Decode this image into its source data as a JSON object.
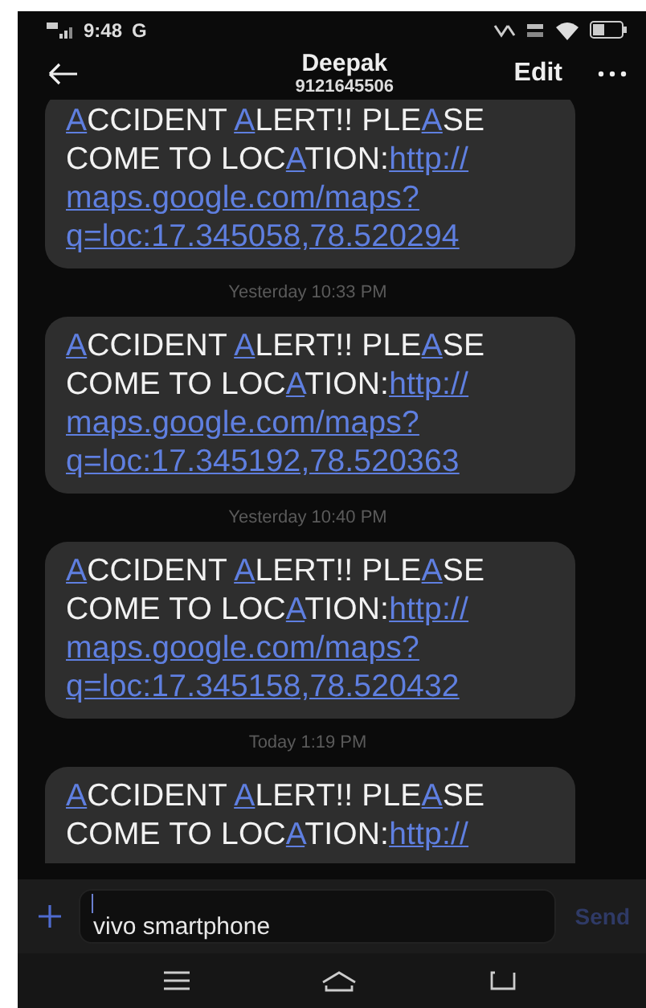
{
  "status_bar": {
    "time": "9:48",
    "carrier_letter": "G"
  },
  "header": {
    "contact_name": "Deepak",
    "phone_number": "9121645506",
    "edit_label": "Edit"
  },
  "messages": [
    {
      "kind": "message",
      "lines": [
        [
          {
            "text": "A",
            "link": true
          },
          {
            "text": "CCIDENT ",
            "link": false
          },
          {
            "text": "A",
            "link": true
          },
          {
            "text": "LERT!! PLE",
            "link": false
          },
          {
            "text": "A",
            "link": true
          },
          {
            "text": "SE",
            "link": false
          }
        ],
        [
          {
            "text": "COME TO LOC",
            "link": false
          },
          {
            "text": "A",
            "link": true
          },
          {
            "text": "TION:",
            "link": false
          },
          {
            "text": "http://",
            "link": true
          }
        ],
        [
          {
            "text": "maps.google.com/maps?",
            "link": true
          }
        ],
        [
          {
            "text": "q=loc:17.345058,78.520294",
            "link": true
          }
        ]
      ]
    },
    {
      "kind": "timestamp",
      "text": "Yesterday 10:33 PM"
    },
    {
      "kind": "message",
      "lines": [
        [
          {
            "text": "A",
            "link": true
          },
          {
            "text": "CCIDENT ",
            "link": false
          },
          {
            "text": "A",
            "link": true
          },
          {
            "text": "LERT!! PLE",
            "link": false
          },
          {
            "text": "A",
            "link": true
          },
          {
            "text": "SE",
            "link": false
          }
        ],
        [
          {
            "text": "COME TO LOC",
            "link": false
          },
          {
            "text": "A",
            "link": true
          },
          {
            "text": "TION:",
            "link": false
          },
          {
            "text": "http://",
            "link": true
          }
        ],
        [
          {
            "text": "maps.google.com/maps?",
            "link": true
          }
        ],
        [
          {
            "text": "q=loc:17.345192,78.520363",
            "link": true
          }
        ]
      ]
    },
    {
      "kind": "timestamp",
      "text": "Yesterday 10:40 PM"
    },
    {
      "kind": "message",
      "lines": [
        [
          {
            "text": "A",
            "link": true
          },
          {
            "text": "CCIDENT ",
            "link": false
          },
          {
            "text": "A",
            "link": true
          },
          {
            "text": "LERT!! PLE",
            "link": false
          },
          {
            "text": "A",
            "link": true
          },
          {
            "text": "SE",
            "link": false
          }
        ],
        [
          {
            "text": "COME TO LOC",
            "link": false
          },
          {
            "text": "A",
            "link": true
          },
          {
            "text": "TION:",
            "link": false
          },
          {
            "text": "http://",
            "link": true
          }
        ],
        [
          {
            "text": "maps.google.com/maps?",
            "link": true
          }
        ],
        [
          {
            "text": "q=loc:17.345158,78.520432",
            "link": true
          }
        ]
      ]
    },
    {
      "kind": "timestamp",
      "text": "Today 1:19 PM"
    },
    {
      "kind": "message",
      "lines": [
        [
          {
            "text": "A",
            "link": true
          },
          {
            "text": "CCIDENT ",
            "link": false
          },
          {
            "text": "A",
            "link": true
          },
          {
            "text": "LERT!! PLE",
            "link": false
          },
          {
            "text": "A",
            "link": true
          },
          {
            "text": "SE",
            "link": false
          }
        ],
        [
          {
            "text": "COME TO LOC",
            "link": false
          },
          {
            "text": "A",
            "link": true
          },
          {
            "text": "TION:",
            "link": false
          },
          {
            "text": "http://",
            "link": true
          }
        ]
      ]
    }
  ],
  "composer": {
    "placeholder": "vivo smartphone",
    "send_label": "Send",
    "send_disabled": true
  }
}
